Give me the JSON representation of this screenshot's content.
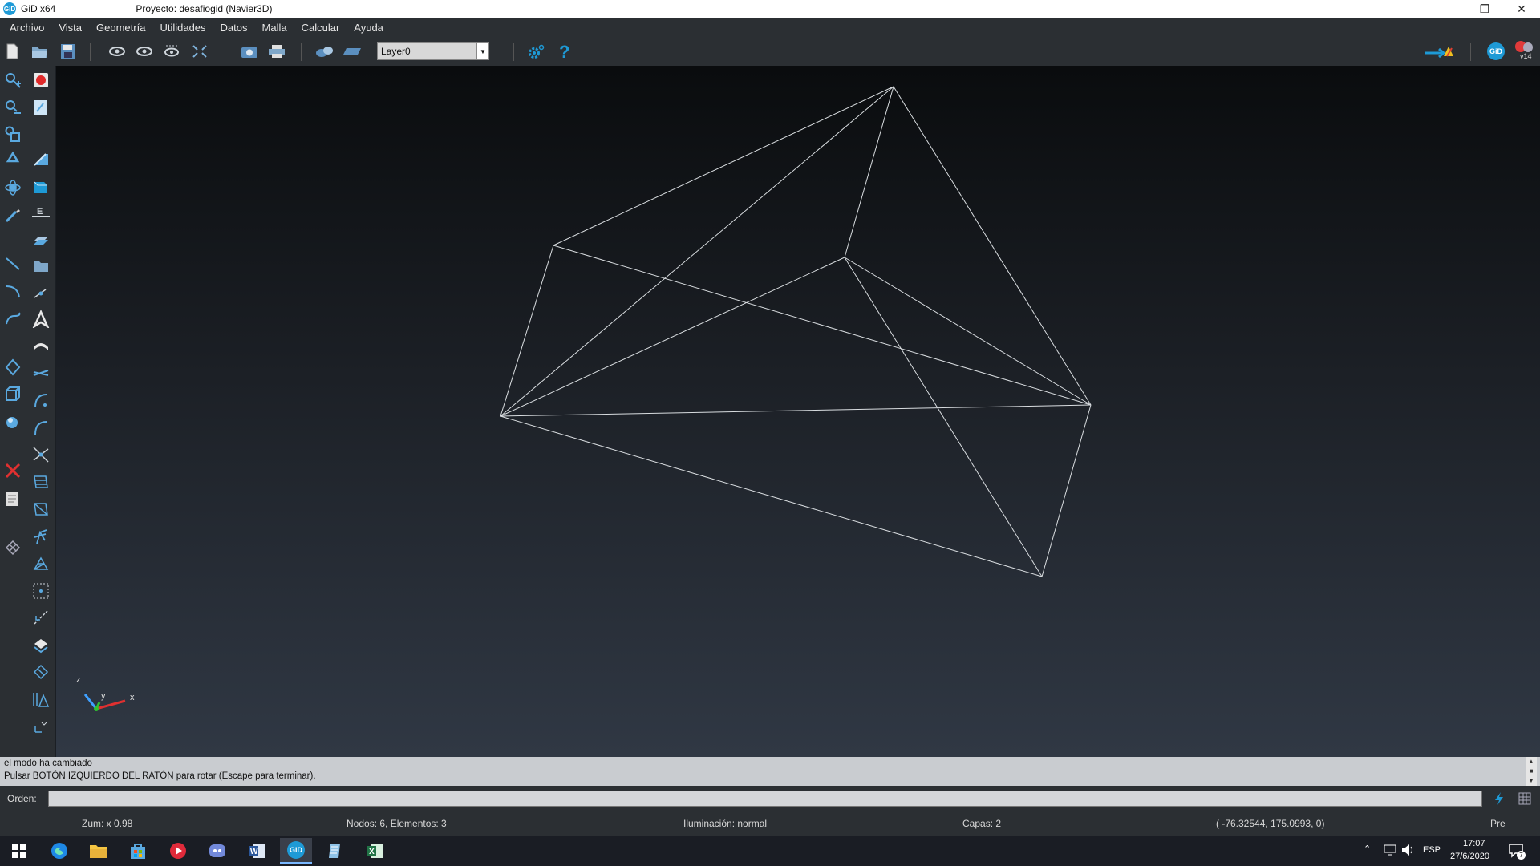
{
  "window": {
    "app_name": "GiD x64",
    "app_logo": "GiD",
    "title": "Proyecto: desafiogid (Navier3D)",
    "minimize": "–",
    "restore": "❐",
    "close": "✕"
  },
  "menu": [
    "Archivo",
    "Vista",
    "Geometría",
    "Utilidades",
    "Datos",
    "Malla",
    "Calcular",
    "Ayuda"
  ],
  "toolbar": {
    "layer": "Layer0",
    "version_badge": "v14",
    "gid_badge": "GiD"
  },
  "axes": {
    "z": "z",
    "y": "y",
    "x": "x"
  },
  "colors": {
    "accent": "#1e9ad6",
    "wireframe": "#d9dde0",
    "panel": "#2b2f33"
  },
  "console": {
    "line1": "el modo ha cambiado",
    "line2": "Pulsar BOTÓN IZQUIERDO DEL RATÓN para rotar (Escape para terminar)."
  },
  "command": {
    "label": "Orden:",
    "value": ""
  },
  "status": {
    "zoom": "Zum: x 0.98",
    "counts": "Nodos: 6, Elementos: 3",
    "lighting": "Iluminación: normal",
    "layers": "Capas: 2",
    "coords": "( -76.32544,  175.0993,  0)",
    "mode": "Pre"
  },
  "taskbar": {
    "language": "ESP",
    "time": "17:07",
    "date": "27/6/2020",
    "notifications": "7"
  }
}
